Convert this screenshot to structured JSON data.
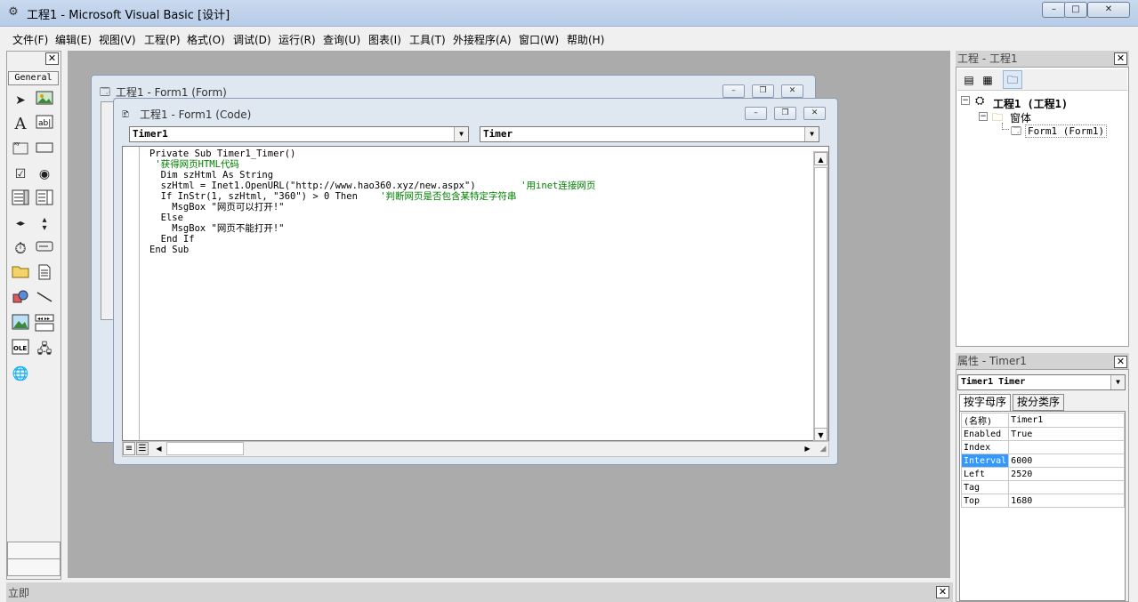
{
  "window": {
    "title": "工程1 - Microsoft Visual Basic [设计]",
    "controls": [
      "–",
      "□",
      "✕"
    ]
  },
  "menu": [
    "文件(F)",
    "编辑(E)",
    "视图(V)",
    "工程(P)",
    "格式(O)",
    "调试(D)",
    "运行(R)",
    "查询(U)",
    "图表(I)",
    "工具(T)",
    "外接程序(A)",
    "窗口(W)",
    "帮助(H)"
  ],
  "toolbox": {
    "close": "✕",
    "tab": "General",
    "tools": [
      "pointer-icon",
      "picturebox-icon",
      "label-icon",
      "textbox-icon",
      "frame-icon",
      "commandbutton-icon",
      "checkbox-icon",
      "optionbutton-icon",
      "combobox-icon",
      "listbox-icon",
      "hscrollbar-icon",
      "vscrollbar-icon",
      "timer-icon",
      "drivelistbox-icon",
      "dirlistbox-icon",
      "filelistbox-icon",
      "shape-icon",
      "line-icon",
      "image-icon",
      "data-icon",
      "ole-icon",
      "inet-icon",
      "webbrowser-icon"
    ]
  },
  "form_window": {
    "title": "工程1 - Form1 (Form)"
  },
  "code_window": {
    "title": "工程1 - Form1 (Code)",
    "object_combo": "Timer1",
    "proc_combo": "Timer",
    "lines": [
      {
        "code": "Private Sub Timer1_Timer()",
        "comment": ""
      },
      {
        "code": " ",
        "comment": "'获得网页HTML代码"
      },
      {
        "code": "  Dim szHtml As String",
        "comment": ""
      },
      {
        "code": "  szHtml = Inet1.OpenURL(\"http://www.hao360.xyz/new.aspx\")        ",
        "comment": "'用inet连接网页"
      },
      {
        "code": "  If InStr(1, szHtml, \"360\") > 0 Then    ",
        "comment": "'判断网页是否包含某特定字符串"
      },
      {
        "code": "    MsgBox \"网页可以打开!\"",
        "comment": ""
      },
      {
        "code": "  Else",
        "comment": ""
      },
      {
        "code": "    MsgBox \"网页不能打开!\"",
        "comment": ""
      },
      {
        "code": "  End If",
        "comment": ""
      },
      {
        "code": "End Sub",
        "comment": ""
      }
    ]
  },
  "project": {
    "header": "工程 - 工程1",
    "root": "工程1 (工程1)",
    "folder": "窗体",
    "form": "Form1 (Form1)"
  },
  "properties": {
    "header": "属性 - Timer1",
    "object_combo": "Timer1 Timer",
    "tabs": [
      "按字母序",
      "按分类序"
    ],
    "rows": [
      {
        "name": "(名称)",
        "value": "Timer1"
      },
      {
        "name": "Enabled",
        "value": "True"
      },
      {
        "name": "Index",
        "value": ""
      },
      {
        "name": "Interval",
        "value": "6000"
      },
      {
        "name": "Left",
        "value": "2520"
      },
      {
        "name": "Tag",
        "value": ""
      },
      {
        "name": "Top",
        "value": "1680"
      }
    ],
    "selected_row": "Interval"
  },
  "immediate": {
    "label": "立即",
    "close": "✕"
  }
}
